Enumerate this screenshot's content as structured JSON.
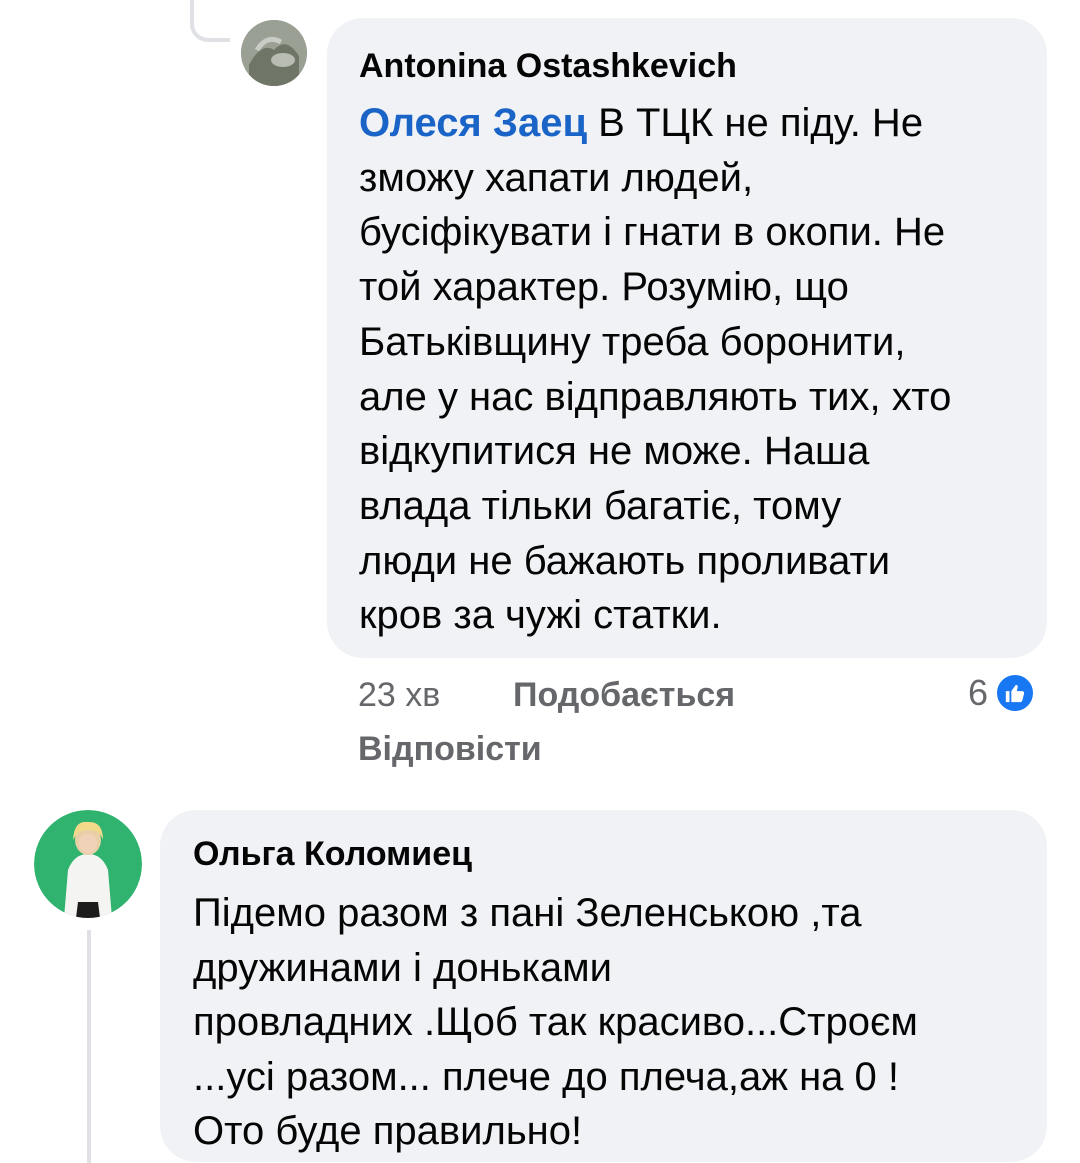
{
  "comment1": {
    "author": "Antonina Ostashkevich",
    "mention": "Олеся Заец",
    "lines": [
      " В ТЦК не піду. Не",
      "зможу хапати людей,",
      "бусіфікувати і гнати в окопи. Не",
      "той характер. Розумію, що",
      "Батьківщину треба боронити,",
      "але у нас відправляють тих, хто",
      "відкупитися не може. Наша",
      "влада тільки багатіє, тому",
      "люди не бажають проливати",
      "кров за чужі статки."
    ],
    "time": "23 хв",
    "like_label": "Подобається",
    "reply_label": "Відповісти",
    "reaction_count": "6",
    "reaction_icon": "like-icon"
  },
  "comment2": {
    "author": "Ольга Коломиец",
    "lines": [
      "Підемо разом з пані Зеленською ,та",
      "дружинами і доньками",
      "провладних .Щоб так красиво...Строєм",
      "...усі разом... плече до плеча,аж на 0 !",
      "Ото буде правильно!"
    ]
  },
  "colors": {
    "bubble": "#f0f2f5",
    "mention": "#1a63c7",
    "meta": "#65676b",
    "like_badge": "#1877f2",
    "avatar2_bg": "#2fb36e"
  }
}
